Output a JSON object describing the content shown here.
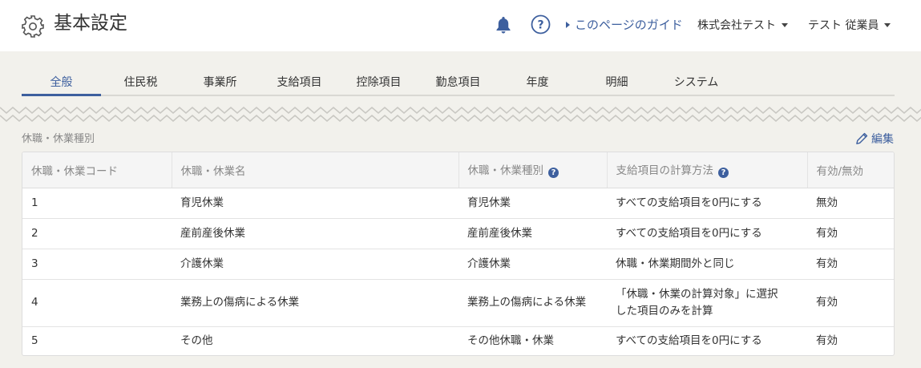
{
  "header": {
    "title": "基本設定",
    "guide_label": "このページのガイド",
    "company_label": "株式会社テスト",
    "user_label": "テスト 従業員",
    "help_glyph": "?"
  },
  "tabs": [
    {
      "label": "全般",
      "active": true
    },
    {
      "label": "住民税"
    },
    {
      "label": "事業所"
    },
    {
      "label": "支給項目"
    },
    {
      "label": "控除項目"
    },
    {
      "label": "勤怠項目"
    },
    {
      "label": "年度"
    },
    {
      "label": "明細"
    },
    {
      "label": "システム"
    }
  ],
  "section": {
    "label": "休職・休業種別",
    "edit_label": "編集"
  },
  "table": {
    "columns": [
      "休職・休業コード",
      "休職・休業名",
      "休職・休業種別",
      "支給項目の計算方法",
      "有効/無効"
    ],
    "help_glyph": "?",
    "rows": [
      {
        "code": "1",
        "name": "育児休業",
        "type": "育児休業",
        "method": "すべての支給項目を0円にする",
        "status": "無効"
      },
      {
        "code": "2",
        "name": "産前産後休業",
        "type": "産前産後休業",
        "method": "すべての支給項目を0円にする",
        "status": "有効"
      },
      {
        "code": "3",
        "name": "介護休業",
        "type": "介護休業",
        "method": "休職・休業期間外と同じ",
        "status": "有効"
      },
      {
        "code": "4",
        "name": "業務上の傷病による休業",
        "type": "業務上の傷病による休業",
        "method_line1": "「休職・休業の計算対象」に選択",
        "method_line2": "した項目のみを計算",
        "status": "有効"
      },
      {
        "code": "5",
        "name": "その他",
        "type": "その他休職・休業",
        "method": "すべての支給項目を0円にする",
        "status": "有効"
      }
    ]
  },
  "colors": {
    "accent": "#3d5f9e",
    "background": "#f2f1ec"
  }
}
